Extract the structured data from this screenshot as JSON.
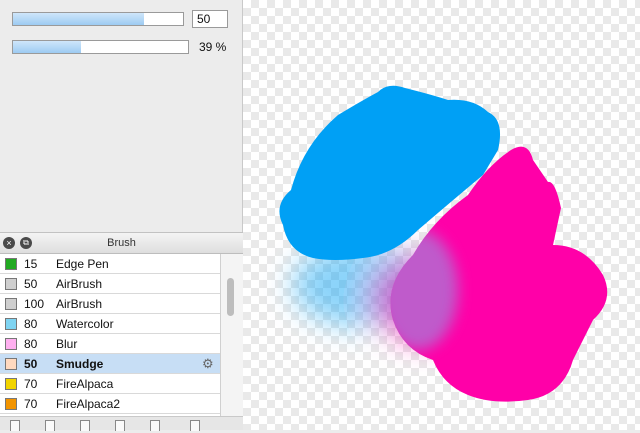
{
  "sliders": {
    "size": {
      "value_text": "50",
      "fraction": 0.77
    },
    "opacity": {
      "value_text": "39 %",
      "fraction": 0.39
    }
  },
  "brush_panel": {
    "title": "Brush",
    "items": [
      {
        "size": "15",
        "name": "Edge Pen",
        "color": "#22aa22",
        "selected": false
      },
      {
        "size": "50",
        "name": "AirBrush",
        "color": "#cfcfcf",
        "selected": false
      },
      {
        "size": "100",
        "name": "AirBrush",
        "color": "#cfcfcf",
        "selected": false
      },
      {
        "size": "80",
        "name": "Watercolor",
        "color": "#7fd4f2",
        "selected": false
      },
      {
        "size": "80",
        "name": "Blur",
        "color": "#ffb0f0",
        "selected": false
      },
      {
        "size": "50",
        "name": "Smudge",
        "color": "#ffd9bf",
        "selected": true
      },
      {
        "size": "70",
        "name": "FireAlpaca",
        "color": "#f2d400",
        "selected": false
      },
      {
        "size": "70",
        "name": "FireAlpaca2",
        "color": "#f29400",
        "selected": false
      }
    ],
    "toolbar_icons": [
      "new-brush-icon",
      "duplicate-brush-icon",
      "edit-brush-icon",
      "folder-icon",
      "import-brush-icon",
      "delete-brush-icon"
    ]
  },
  "canvas": {
    "stroke_blue": "#00a0f5",
    "stroke_pink": "#ff00a8"
  }
}
